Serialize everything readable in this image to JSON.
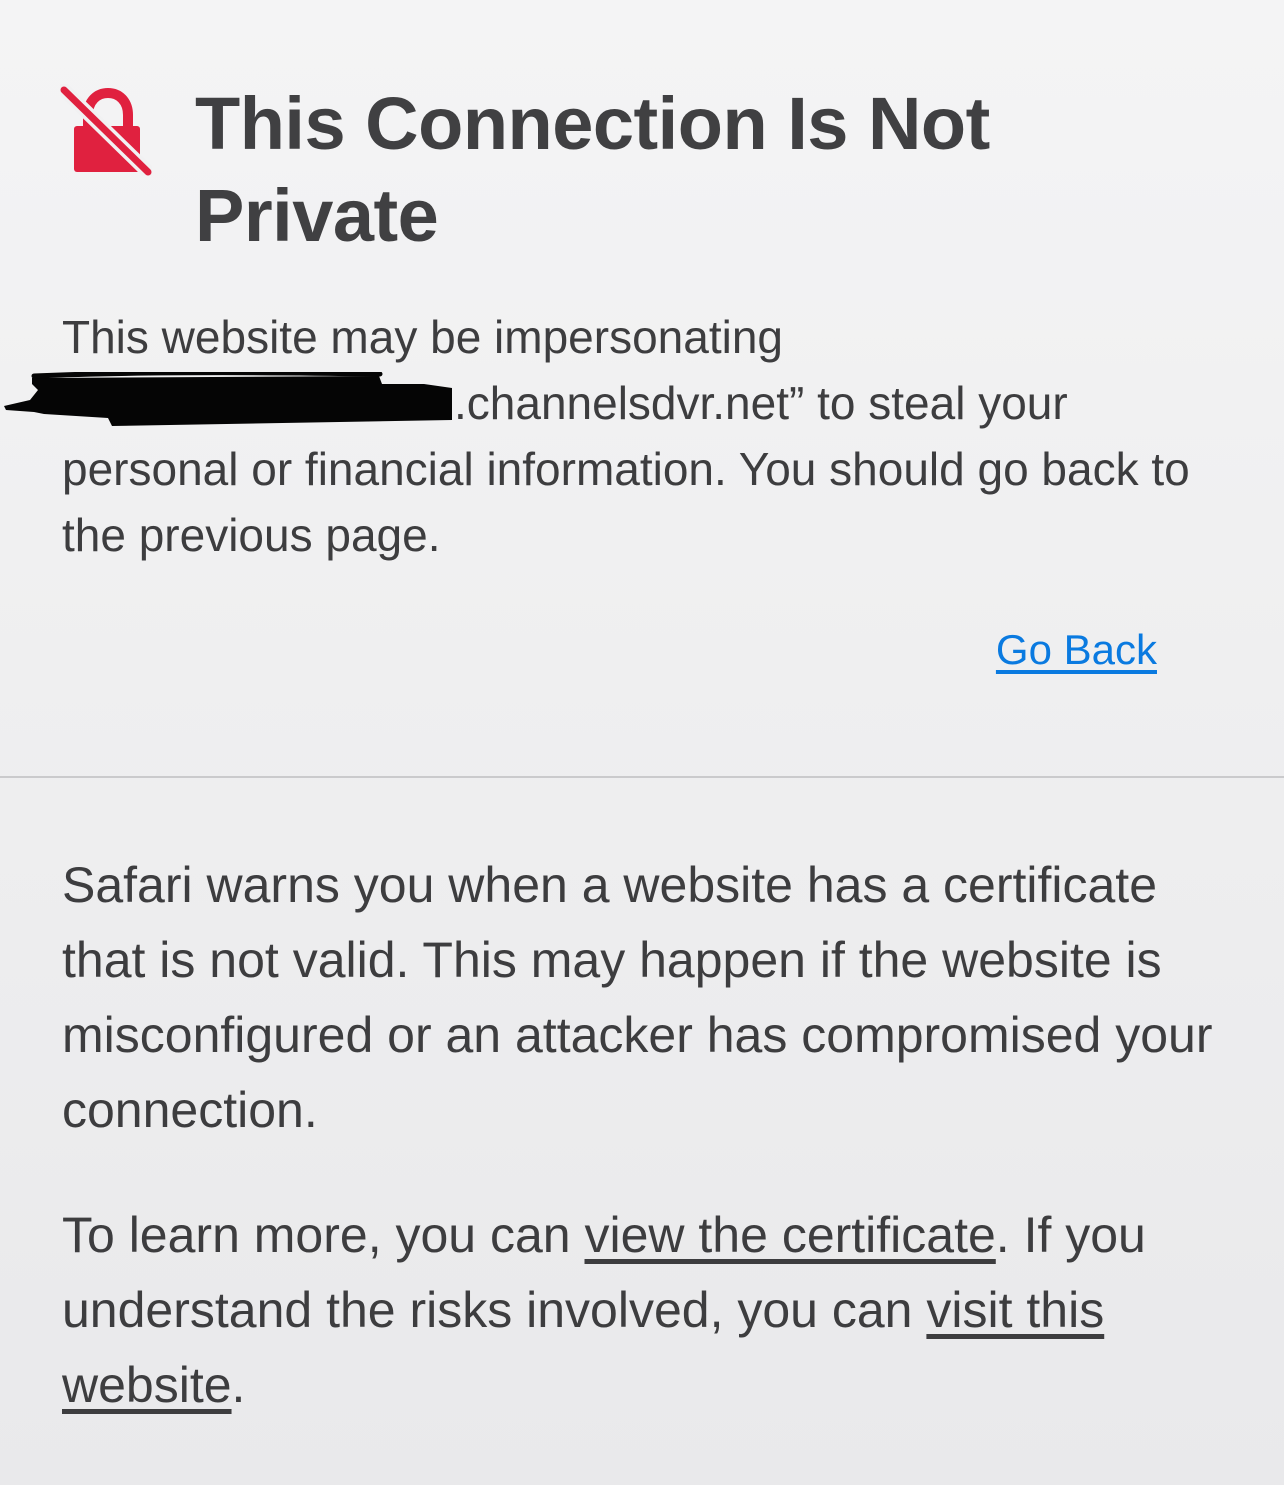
{
  "warning": {
    "icon": "broken-lock-icon",
    "title": "This Connection Is Not Private",
    "message_before_redaction": "This website may be impersonating",
    "message_after_redaction": ".channelsdvr.net” to steal your personal or financial information. You should go back to the previous page.",
    "go_back_label": "Go Back"
  },
  "details": {
    "paragraph": "Safari warns you when a website has a certificate that is not valid. This may happen if the website is misconfigured or an attacker has compromised your connection.",
    "learn_more_prefix": "To learn more, you can",
    "view_certificate_link": "view the certificate",
    "middle_text": ". If you understand the risks involved, you can",
    "visit_website_link": "visit this website",
    "suffix": "."
  },
  "colors": {
    "icon_red": "#e0213f",
    "link_blue": "#0a7ae0",
    "text_gray": "#3d3d3f",
    "background": "#f0f0f1"
  }
}
